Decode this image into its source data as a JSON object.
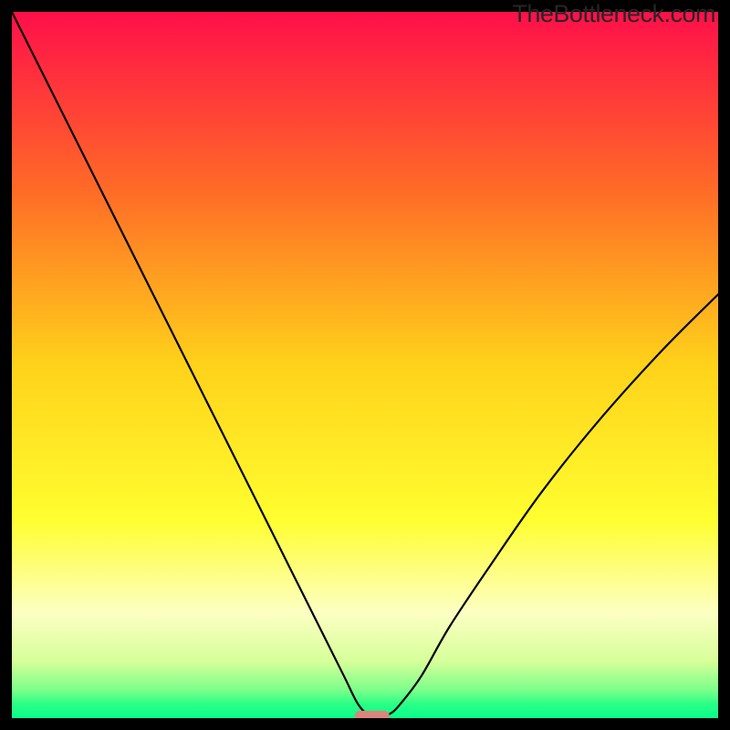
{
  "watermark": "TheBottleneck.com",
  "chart_data": {
    "type": "line",
    "title": "",
    "xlabel": "",
    "ylabel": "",
    "xlim": [
      0,
      100
    ],
    "ylim": [
      0,
      100
    ],
    "series": [
      {
        "name": "bottleneck-curve",
        "x": [
          0,
          5,
          10,
          15,
          20,
          25,
          30,
          35,
          40,
          44,
          47,
          49,
          50.5,
          52,
          53.5,
          55,
          58,
          62,
          68,
          75,
          83,
          92,
          100
        ],
        "y": [
          100,
          90,
          80,
          70,
          60,
          50,
          40,
          30,
          20,
          12,
          6,
          2,
          0.5,
          0.5,
          0.6,
          2,
          6,
          13,
          22,
          32,
          42,
          52,
          60
        ]
      }
    ],
    "marker": {
      "x": 51,
      "y": 0.4,
      "color": "#d9867d"
    },
    "gradient_stops": [
      {
        "pct": 0,
        "color": "#ff0f4a"
      },
      {
        "pct": 25,
        "color": "#ff6a27"
      },
      {
        "pct": 50,
        "color": "#ffd21a"
      },
      {
        "pct": 72,
        "color": "#fffe30"
      },
      {
        "pct": 85,
        "color": "#fdffc2"
      },
      {
        "pct": 92,
        "color": "#d6ff9a"
      },
      {
        "pct": 96,
        "color": "#7dff8b"
      },
      {
        "pct": 98,
        "color": "#2aff85"
      },
      {
        "pct": 100,
        "color": "#08ff8b"
      }
    ]
  }
}
